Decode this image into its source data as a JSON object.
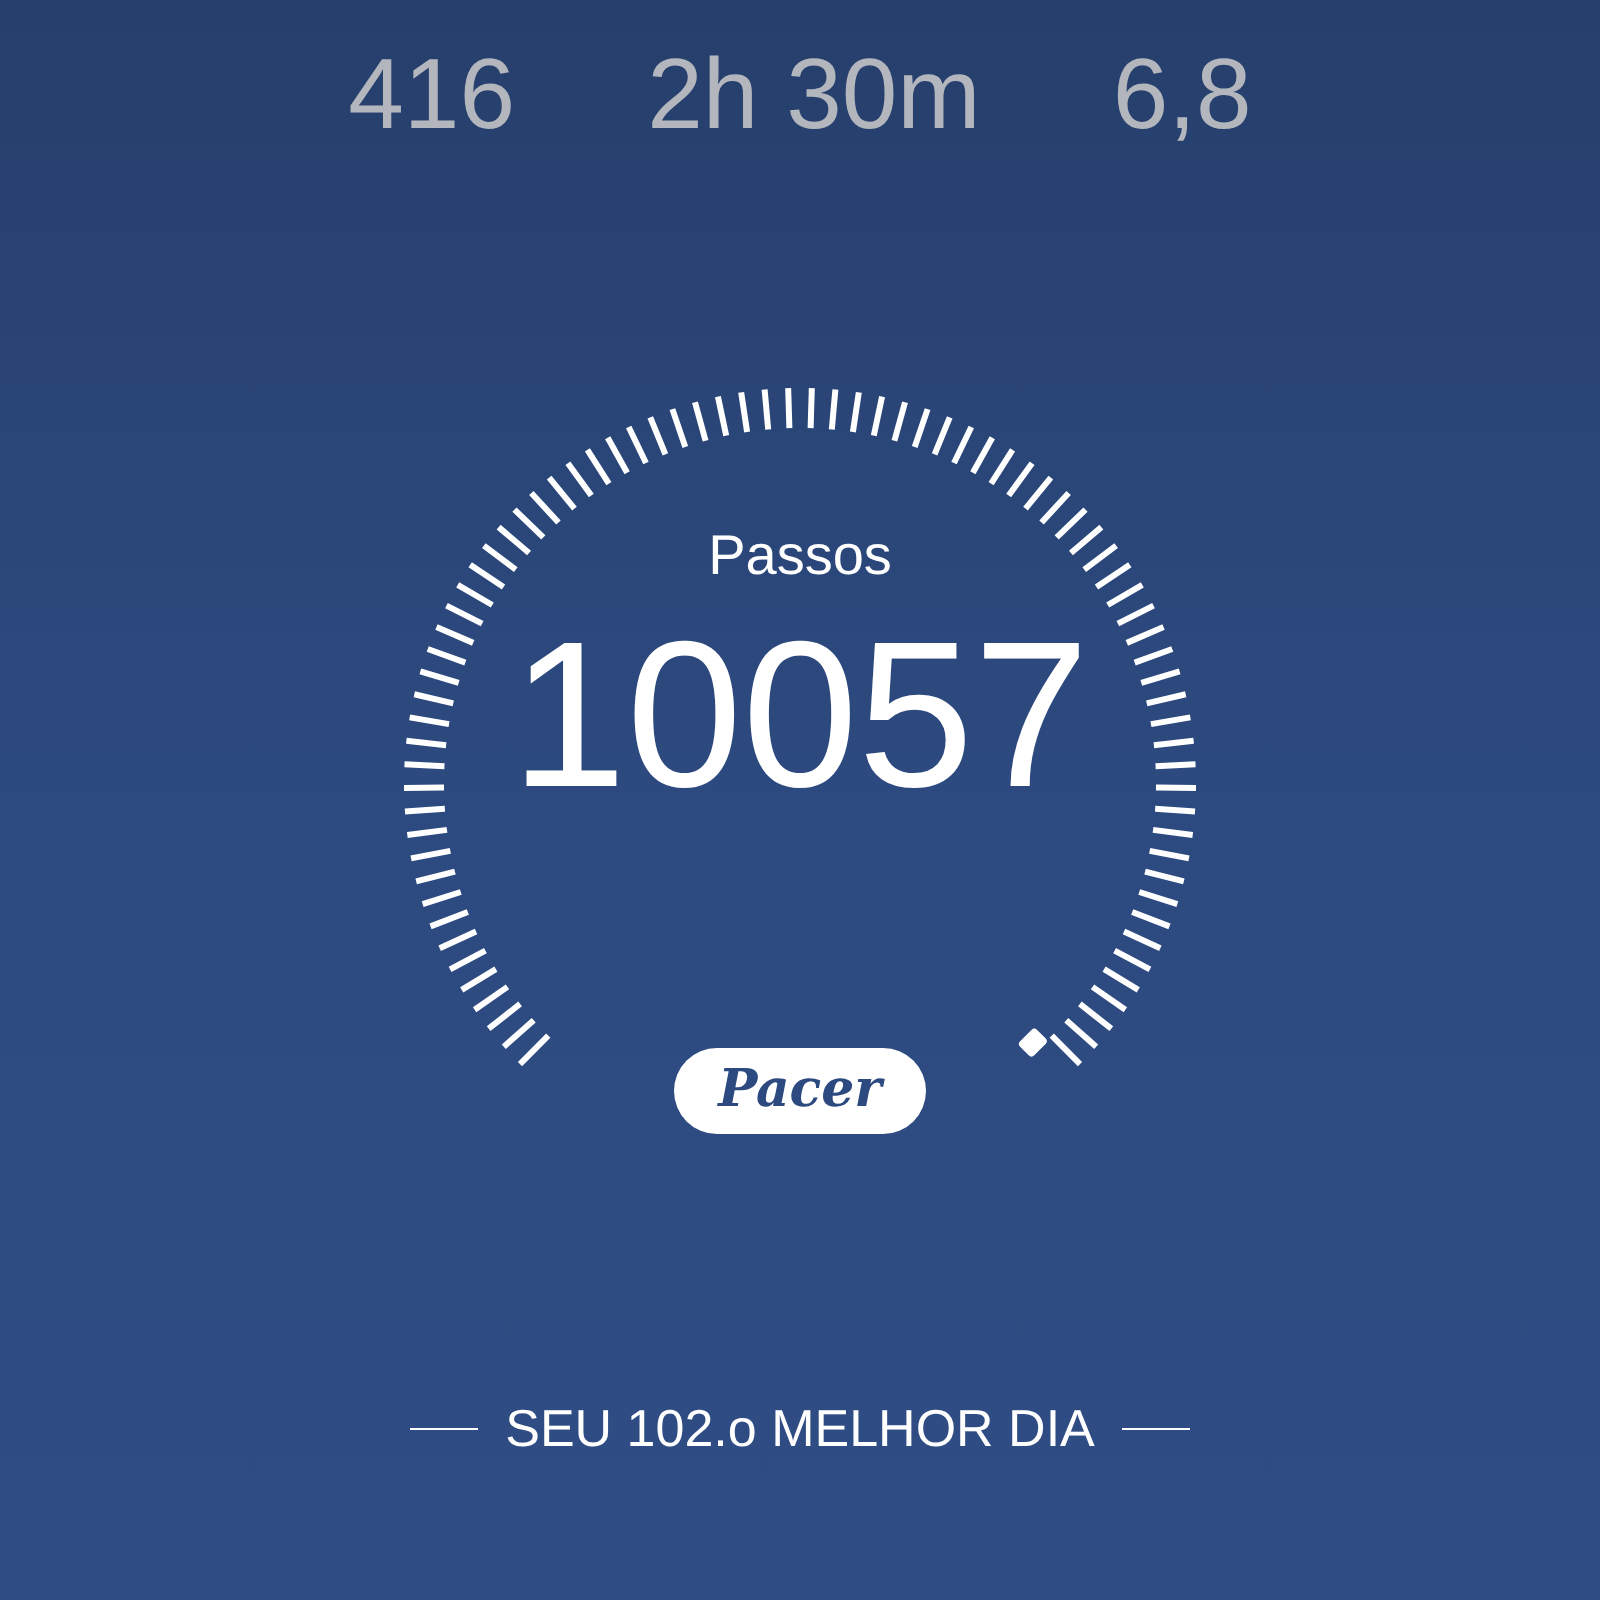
{
  "stats": [
    {
      "value": "416"
    },
    {
      "value": "2h 30m"
    },
    {
      "value": "6,8"
    }
  ],
  "gauge": {
    "label": "Passos",
    "value": "10057"
  },
  "logo": {
    "text": "Pacer"
  },
  "best_day": {
    "text": "SEU 102.o MELHOR DIA"
  }
}
